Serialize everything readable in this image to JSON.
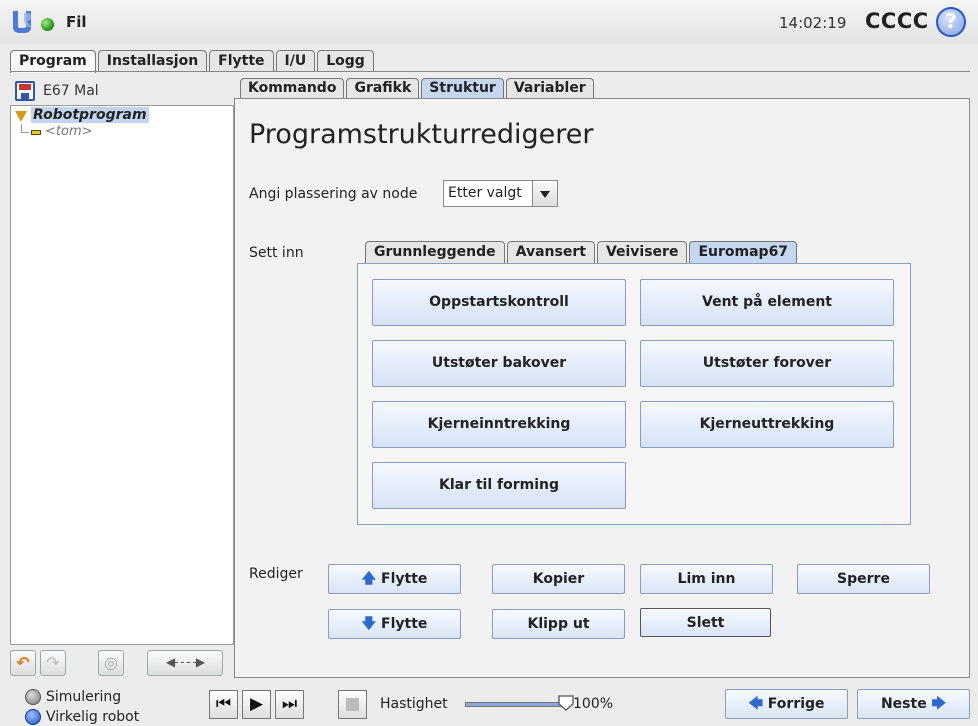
{
  "topbar": {
    "file_label": "Fil",
    "clock": "14:02:19",
    "robot_name": "CCCC",
    "help_icon": "?"
  },
  "main_tabs": [
    "Program",
    "Installasjon",
    "Flytte",
    "I/U",
    "Logg"
  ],
  "program": {
    "name": "E67 Mal",
    "tree_root": "Robotprogram",
    "tree_child": "<tom>"
  },
  "sub_tabs": [
    "Kommando",
    "Grafikk",
    "Struktur",
    "Variabler"
  ],
  "structure": {
    "title": "Programstrukturredigerer",
    "position_label": "Angi plassering av node",
    "position_value": "Etter valgt",
    "insert_label": "Sett inn",
    "insert_tabs": [
      "Grunnleggende",
      "Avansert",
      "Veivisere",
      "Euromap67"
    ],
    "insert_buttons": [
      "Oppstartskontroll",
      "Vent på element",
      "Utstøter bakover",
      "Utstøter forover",
      "Kjerneinntrekking",
      "Kjerneuttrekking",
      "Klar til forming"
    ],
    "edit_label": "Rediger",
    "edit_buttons": {
      "move_up": "Flytte",
      "copy": "Kopier",
      "paste": "Lim inn",
      "suppress": "Sperre",
      "move_down": "Flytte",
      "cut": "Klipp ut",
      "delete": "Slett"
    }
  },
  "bottombar": {
    "simulation": "Simulering",
    "real_robot": "Virkelig robot",
    "speed_label": "Hastighet",
    "speed_value": "100%",
    "speed_fraction": 1.0,
    "prev": "Forrige",
    "next": "Neste"
  },
  "colors": {
    "selected_tab": "#c5d7f0",
    "button_blue": "#d6e2f5",
    "accent_arrow": "#2d6ad0"
  }
}
